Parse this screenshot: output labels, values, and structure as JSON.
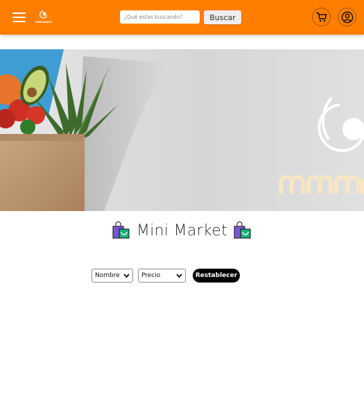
{
  "navbar": {
    "logo_text": "MMMARKET",
    "search": {
      "placeholder": "¿Qué estas buscando?",
      "value": ""
    },
    "search_button_label": "Buscar",
    "icons": [
      "menu-icon",
      "cart-icon",
      "user-icon"
    ],
    "background_color": "#ff7e00"
  },
  "banner": {
    "logo_text": "MMMARKET"
  },
  "main": {
    "title": "Mini Market",
    "title_icon": "shopping-bags-icon"
  },
  "filters": {
    "sort_name": {
      "selected": "Nombre"
    },
    "sort_price": {
      "selected": "Precio"
    },
    "reset_label": "Restablecer"
  }
}
